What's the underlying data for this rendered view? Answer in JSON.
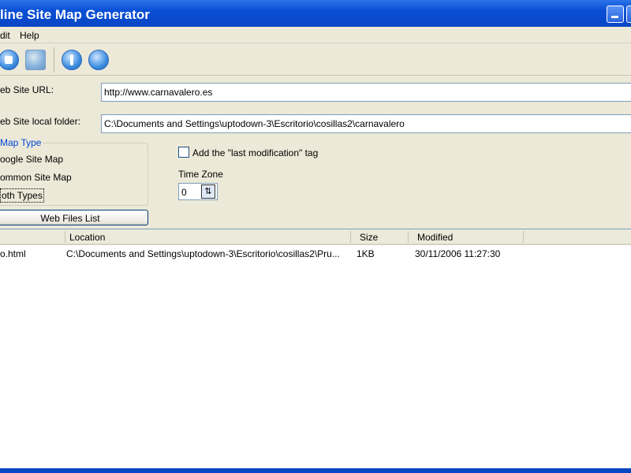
{
  "window": {
    "title": "line Site Map Generator"
  },
  "menu": [
    "dit",
    "Help"
  ],
  "toolbar": {
    "icons": [
      "stop-icon",
      "document-globe-icon",
      "info-icon",
      "globe-icon"
    ]
  },
  "form": {
    "url_label": "eb Site URL:",
    "url_value": "http://www.carnavalero.es",
    "folder_label": "eb Site local folder:",
    "folder_value": "C:\\Documents and Settings\\uptodown-3\\Escritorio\\cosillas2\\carnavalero",
    "map_type_label": "Map Type",
    "map_types": [
      "oogle Site Map",
      "ommon Site Map",
      "oth Types"
    ],
    "selected_map_type": "oth Types",
    "last_mod_label": "Add the \"last modification\" tag",
    "last_mod_checked": false,
    "timezone_label": "Time Zone",
    "timezone_value": "0",
    "files_button": "Web Files List"
  },
  "list": {
    "columns": [
      "Location",
      "Size",
      "Modified"
    ],
    "rows": [
      {
        "name": "o.html",
        "location": "C:\\Documents and Settings\\uptodown-3\\Escritorio\\cosillas2\\Pru...",
        "size": "1KB",
        "modified": "30/11/2006 11:27:30"
      }
    ]
  }
}
